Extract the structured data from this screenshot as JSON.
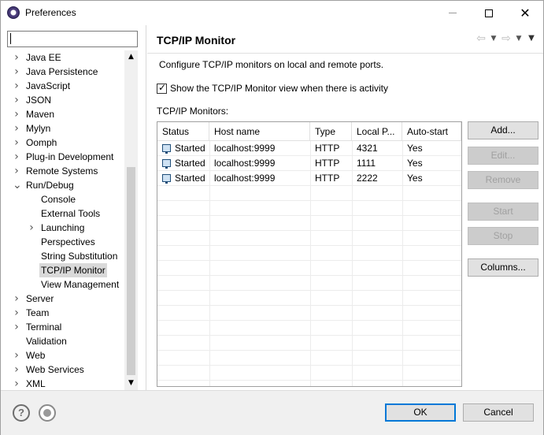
{
  "window": {
    "title": "Preferences"
  },
  "filter": {
    "value": "",
    "placeholder": ""
  },
  "tree": [
    {
      "label": "Java EE",
      "expandable": true,
      "expanded": false,
      "level": 0
    },
    {
      "label": "Java Persistence",
      "expandable": true,
      "expanded": false,
      "level": 0
    },
    {
      "label": "JavaScript",
      "expandable": true,
      "expanded": false,
      "level": 0
    },
    {
      "label": "JSON",
      "expandable": true,
      "expanded": false,
      "level": 0
    },
    {
      "label": "Maven",
      "expandable": true,
      "expanded": false,
      "level": 0
    },
    {
      "label": "Mylyn",
      "expandable": true,
      "expanded": false,
      "level": 0
    },
    {
      "label": "Oomph",
      "expandable": true,
      "expanded": false,
      "level": 0
    },
    {
      "label": "Plug-in Development",
      "expandable": true,
      "expanded": false,
      "level": 0
    },
    {
      "label": "Remote Systems",
      "expandable": true,
      "expanded": false,
      "level": 0
    },
    {
      "label": "Run/Debug",
      "expandable": true,
      "expanded": true,
      "level": 0
    },
    {
      "label": "Console",
      "expandable": false,
      "level": 1
    },
    {
      "label": "External Tools",
      "expandable": false,
      "level": 1
    },
    {
      "label": "Launching",
      "expandable": true,
      "expanded": false,
      "level": 1
    },
    {
      "label": "Perspectives",
      "expandable": false,
      "level": 1
    },
    {
      "label": "String Substitution",
      "expandable": false,
      "level": 1
    },
    {
      "label": "TCP/IP Monitor",
      "expandable": false,
      "level": 1,
      "selected": true
    },
    {
      "label": "View Management",
      "expandable": false,
      "level": 1
    },
    {
      "label": "Server",
      "expandable": true,
      "expanded": false,
      "level": 0
    },
    {
      "label": "Team",
      "expandable": true,
      "expanded": false,
      "level": 0
    },
    {
      "label": "Terminal",
      "expandable": true,
      "expanded": false,
      "level": 0
    },
    {
      "label": "Validation",
      "expandable": false,
      "level": 0
    },
    {
      "label": "Web",
      "expandable": true,
      "expanded": false,
      "level": 0
    },
    {
      "label": "Web Services",
      "expandable": true,
      "expanded": false,
      "level": 0
    },
    {
      "label": "XML",
      "expandable": true,
      "expanded": false,
      "level": 0
    }
  ],
  "page": {
    "title": "TCP/IP Monitor",
    "description": "Configure TCP/IP monitors on local and remote ports.",
    "show_view_checkbox": {
      "label": "Show the TCP/IP Monitor view when there is activity",
      "checked": true
    },
    "monitors_label": "TCP/IP Monitors:"
  },
  "table": {
    "columns": [
      "Status",
      "Host name",
      "Type",
      "Local P...",
      "Auto-start"
    ],
    "rows": [
      {
        "status": "Started",
        "host": "localhost:9999",
        "type": "HTTP",
        "local_port": "4321",
        "auto_start": "Yes"
      },
      {
        "status": "Started",
        "host": "localhost:9999",
        "type": "HTTP",
        "local_port": "1111",
        "auto_start": "Yes"
      },
      {
        "status": "Started",
        "host": "localhost:9999",
        "type": "HTTP",
        "local_port": "2222",
        "auto_start": "Yes"
      }
    ]
  },
  "buttons": {
    "add": "Add...",
    "edit": "Edit...",
    "remove": "Remove",
    "start": "Start",
    "stop": "Stop",
    "columns": "Columns...",
    "ok": "OK",
    "cancel": "Cancel"
  },
  "icons": {
    "help": "?",
    "record": "record-macro-icon"
  }
}
